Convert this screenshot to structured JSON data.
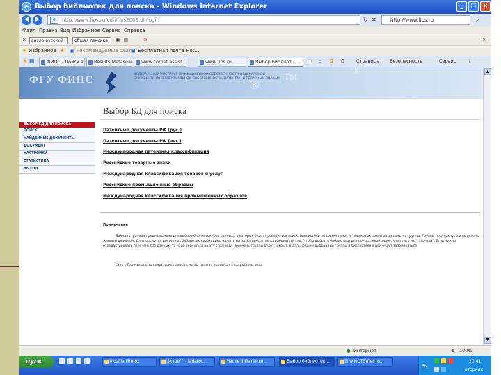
{
  "window": {
    "title": "Выбор библиотек для поиска - Windows Internet Explorer",
    "address": "http://www.fips.ru/cdfi/fips2003.dll/login",
    "search_text": "http://www.fips.ru"
  },
  "menu": [
    "Файл",
    "Правка",
    "Вид",
    "Избранное",
    "Сервис",
    "Справка"
  ],
  "translate_bar": {
    "language": "англо-русский",
    "topic": "общая лексика"
  },
  "favorites": {
    "label": "Избранное",
    "items": [
      "Рекомендуемые сайты",
      "Бесплатная почта Hot..."
    ]
  },
  "tabs": [
    "ФИПС - Поиск в б...",
    "Results Metasear...",
    "www.cornet assist...",
    "www.fips.ru",
    "Выбор библиот..."
  ],
  "tab_tools": [
    "Страница",
    "Безопасность",
    "Сервис"
  ],
  "site": {
    "logo": "ФГУ ФИПС",
    "banner_text": "ФЕДЕРАЛЬНЫЙ ИНСТИТУТ ПРОМЫШЛЕННОЙ СОБСТВЕННОСТИ ФЕДЕРАЛЬНОЙ СЛУЖБЫ ПО ИНТЕЛЛЕКТУАЛЬНОЙ СОБСТВЕННОСТИ, ПАТЕНТАМ И ТОВАРНЫМ ЗНАКАМ",
    "page_title": "Выбор БД для поиска",
    "left_menu_header": "ВЫБОР БД ДЛЯ ПОИСКА",
    "left_menu": [
      "ПОИСК",
      "НАЙДЕННЫЕ ДОКУМЕНТЫ",
      "ДОКУМЕНТ",
      "НАСТРОЙКИ",
      "СТАТИСТИКА",
      "ВЫХОД"
    ],
    "databases": [
      "Патентные документы РФ (рус.)",
      "Патентные документы РФ (анг.)",
      "Международная патентная классификация",
      "Российские товарные знаки",
      "Международная классификация товаров и услуг",
      "Российские промышленные образцы",
      "Международная классификация промышленных образцов"
    ],
    "note_title": "Примечание",
    "note_p1": "Данная страница предназначена для выбора библиотек (баз данных), в которых будет проводиться поиск. Библиотеки по совместимости поисковых полей разделены на группы. Группы подчеркнуты и выделены жирным шрифтом. Для просмотра доступных библиотек необходимо нажать на название соответствующей группы. Чтобы выбрать библиотеки для поиска, необходимо отметить их \"галочкой\". Если нужно отредактировать перечень баз данных, то надо вернуться на эту страницу. Перечень группы будет закрыт. В дальнейшем выбранные группы и библиотеки в ней будут запоминаться.",
    "note_p2": "Если у Вас появились вопросы/пожелания, то вы можете связаться с разработчиками."
  },
  "status": {
    "zone": "Интернет",
    "zoom": "100%"
  },
  "taskbar": {
    "start": "пуск",
    "tasks": [
      "Mozilla Firefox",
      "Skype™ - ladatoc...",
      "Часть II Патентн...",
      "Выбор библиотек...",
      "В:\\ИНСТЭ\\Лесто..."
    ],
    "lang": "EN",
    "time": "20:41",
    "date": "вторник"
  }
}
